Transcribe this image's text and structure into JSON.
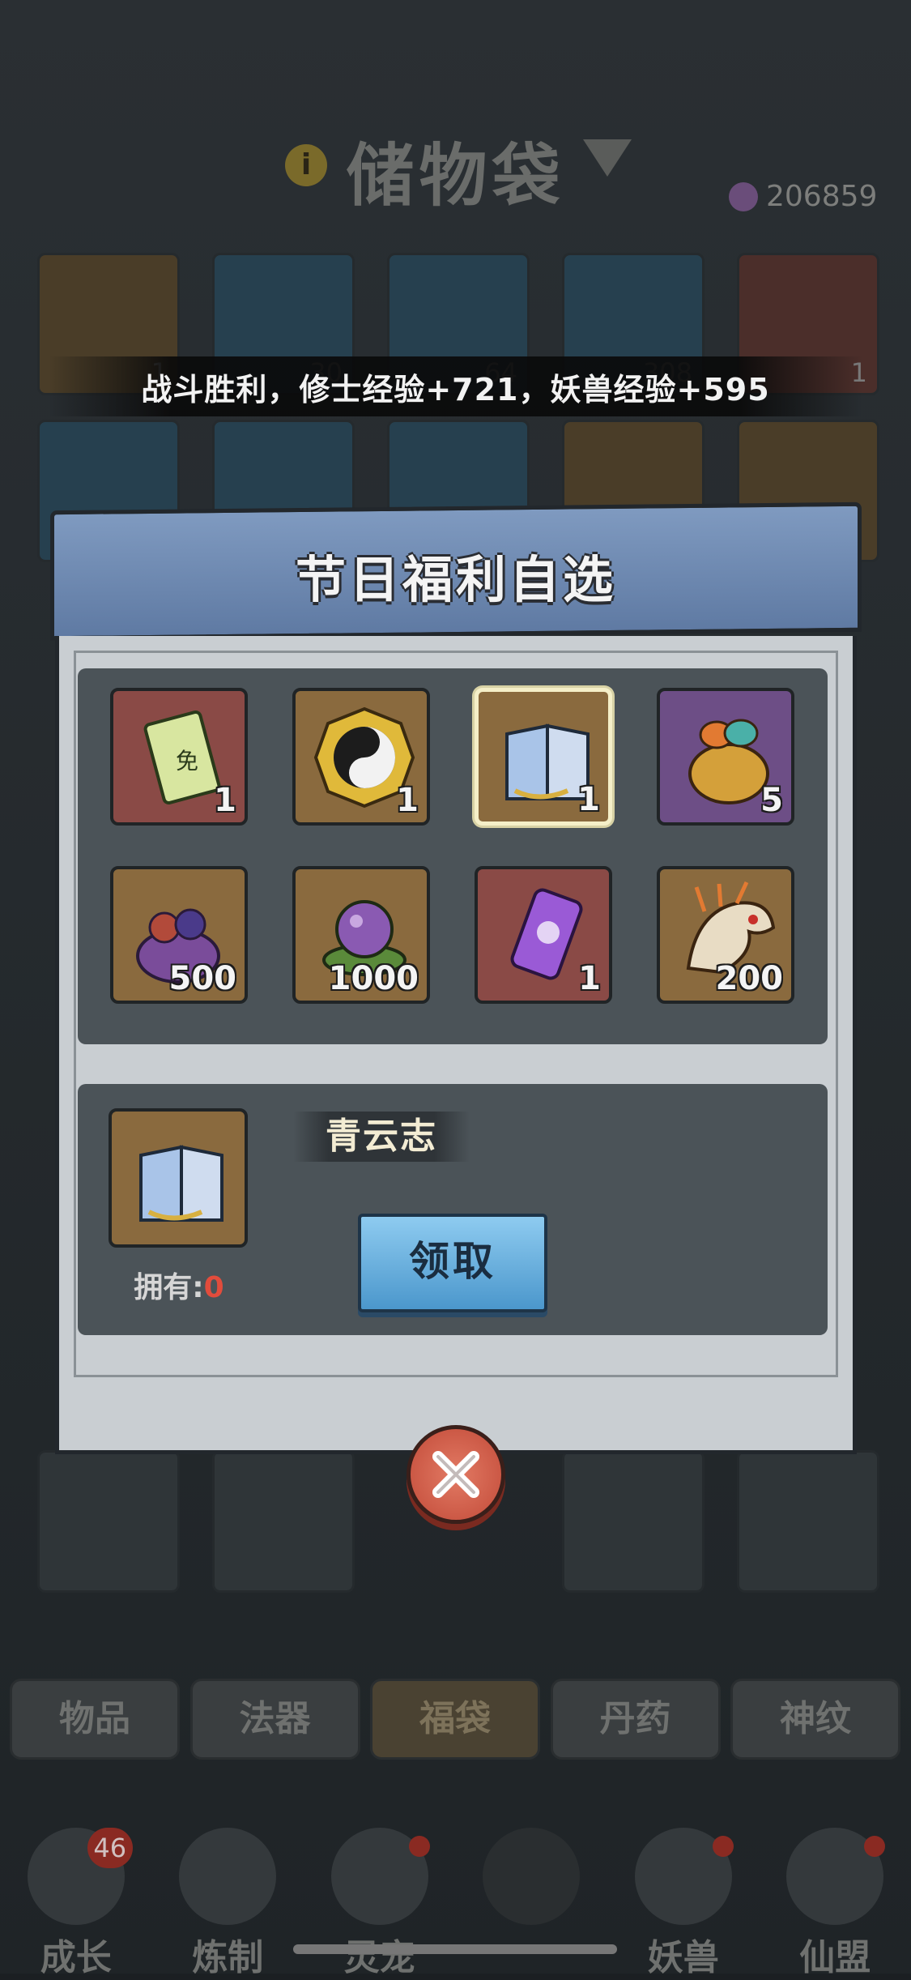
{
  "background": {
    "title": "储物袋",
    "currency_value": "206859",
    "slot_counts": [
      "1",
      "30",
      "64",
      "308",
      "1"
    ],
    "tabs": [
      "物品",
      "法器",
      "福袋",
      "丹药",
      "神纹"
    ],
    "nav": [
      {
        "label": "成长",
        "badge": "46",
        "icon": "growth-icon"
      },
      {
        "label": "炼制",
        "icon": "forge-icon"
      },
      {
        "label": "灵宠",
        "icon": "spirit-pet-icon"
      },
      {
        "label": "",
        "icon": "close-icon"
      },
      {
        "label": "妖兽",
        "icon": "demon-beast-icon"
      },
      {
        "label": "仙盟",
        "icon": "immortal-alliance-icon"
      }
    ]
  },
  "toast": {
    "text": "战斗胜利，修士经验+721，妖兽经验+595"
  },
  "modal": {
    "title": "节日福利自选",
    "items": [
      {
        "qty": "1",
        "bg": "red",
        "icon": "immunity-scroll-icon"
      },
      {
        "qty": "1",
        "bg": "gold",
        "icon": "taiji-medallion-icon"
      },
      {
        "qty": "1",
        "bg": "gold",
        "icon": "book-icon",
        "selected": true
      },
      {
        "qty": "5",
        "bg": "purple",
        "icon": "treasure-bag-icon"
      },
      {
        "qty": "500",
        "bg": "gold",
        "icon": "gem-bag-icon"
      },
      {
        "qty": "1000",
        "bg": "gold",
        "icon": "spirit-orb-icon"
      },
      {
        "qty": "1",
        "bg": "red",
        "icon": "purple-talisman-icon"
      },
      {
        "qty": "200",
        "bg": "gold",
        "icon": "dragon-icon"
      }
    ],
    "detail": {
      "name": "青云志",
      "own_label": "拥有:",
      "own_value": "0",
      "claim_label": "领取",
      "icon": "book-icon"
    }
  },
  "colors": {
    "accent_blue": "#5f7aa3",
    "button_blue": "#6cb3e2",
    "close_red": "#d35f4b",
    "own_red": "#e24c3c"
  }
}
